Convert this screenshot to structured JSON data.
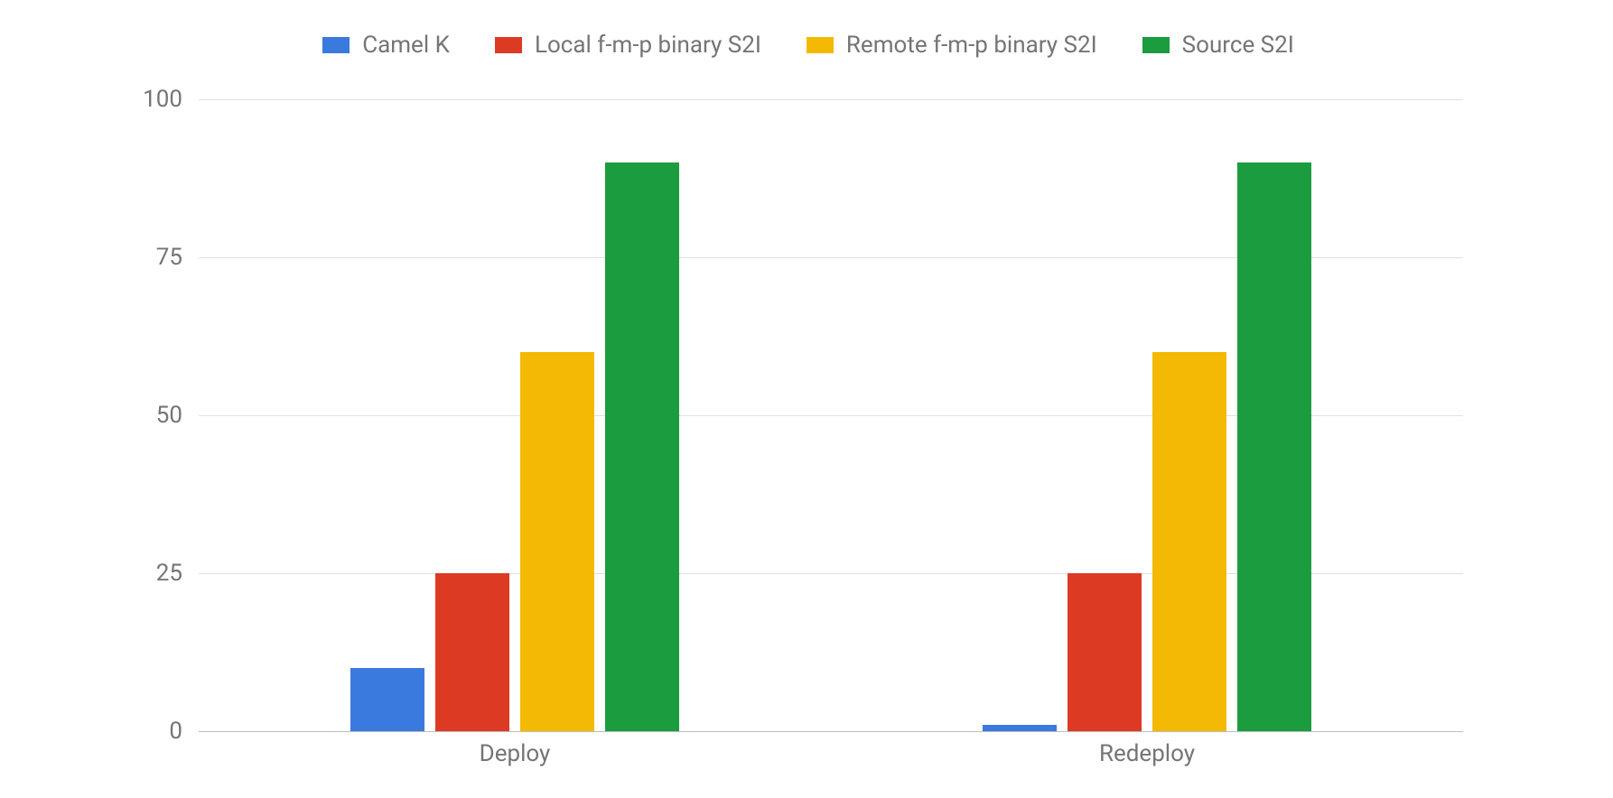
{
  "chart_data": {
    "type": "bar",
    "categories": [
      "Deploy",
      "Redeploy"
    ],
    "series": [
      {
        "name": "Camel K",
        "color": "#3a7ade",
        "values": [
          10,
          1
        ]
      },
      {
        "name": "Local f-m-p binary S2I",
        "color": "#dd3a24",
        "values": [
          25,
          25
        ]
      },
      {
        "name": "Remote f-m-p binary S2I",
        "color": "#f4b905",
        "values": [
          60,
          60
        ]
      },
      {
        "name": "Source S2I",
        "color": "#1b9c3f",
        "values": [
          90,
          90
        ]
      }
    ],
    "ylim": [
      0,
      100
    ],
    "yticks": [
      0,
      25,
      50,
      75,
      100
    ],
    "title": "",
    "xlabel": "",
    "ylabel": ""
  }
}
